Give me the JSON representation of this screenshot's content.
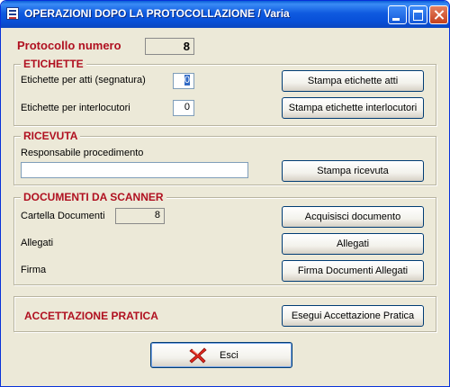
{
  "window": {
    "title": "OPERAZIONI DOPO LA PROTOCOLLAZIONE / Varia"
  },
  "protocollo": {
    "label": "Protocollo numero",
    "value": "8"
  },
  "etichette": {
    "heading": "ETICHETTE",
    "atti_label": "Etichette per atti (segnatura)",
    "atti_value": "0",
    "interlocutori_label": "Etichette per interlocutori",
    "interlocutori_value": "0",
    "stampa_atti_button": "Stampa etichette atti",
    "stampa_interlocutori_button": "Stampa etichette interlocutori"
  },
  "ricevuta": {
    "heading": "RICEVUTA",
    "responsabile_label": "Responsabile procedimento",
    "responsabile_value": "",
    "stampa_button": "Stampa ricevuta"
  },
  "documenti": {
    "heading": "DOCUMENTI DA SCANNER",
    "cartella_label": "Cartella Documenti",
    "cartella_value": "8",
    "acquisisci_button": "Acquisisci documento",
    "allegati_label": "Allegati",
    "allegati_button": "Allegati",
    "firma_label": "Firma",
    "firma_button": "Firma Documenti Allegati"
  },
  "accettazione": {
    "heading": "ACCETTAZIONE PRATICA",
    "esegui_button": "Esegui Accettazione Pratica"
  },
  "esci_button": "Esci",
  "icons": {
    "window": "form-icon",
    "esci": "red-x-icon"
  },
  "colors": {
    "title_bar": "#0a5fd8",
    "heading": "#b01020",
    "background": "#ece9d8"
  }
}
